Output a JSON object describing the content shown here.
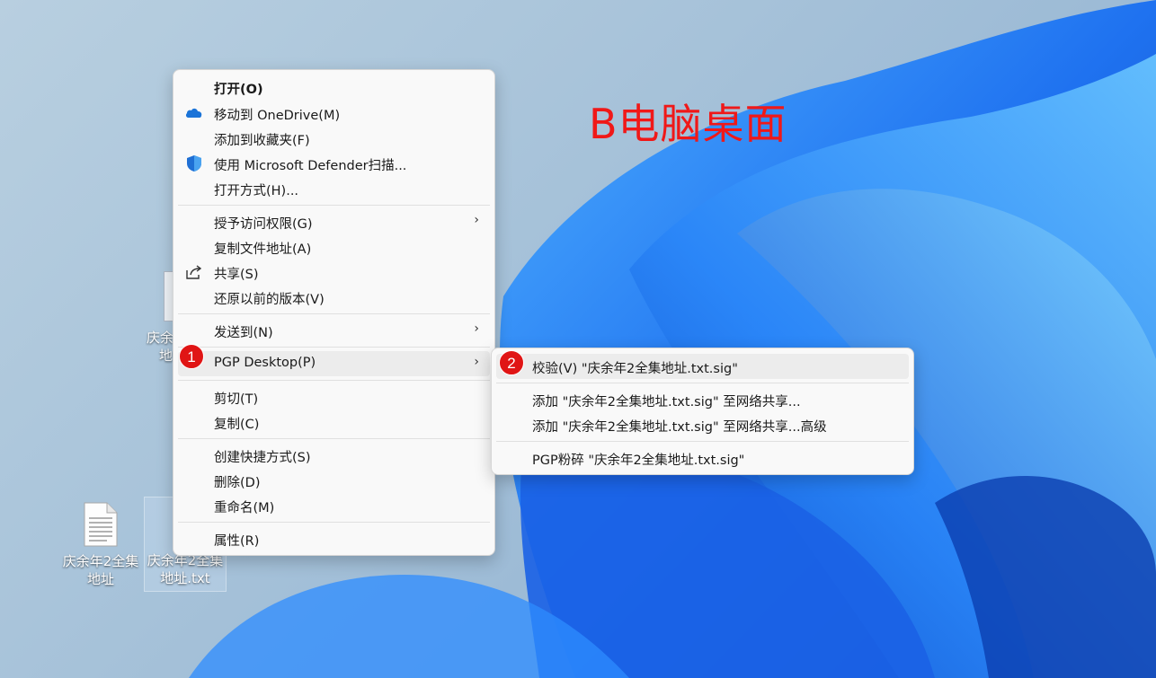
{
  "desktop": {
    "title": "B电脑桌面",
    "icons": [
      {
        "label_line1": "庆余年2全集",
        "label_line2": "地址"
      },
      {
        "label_line1": "庆余年2全集",
        "label_line2": "地址.txt"
      },
      {
        "label_partial_1": "庆余",
        "label_partial_2": "地"
      }
    ]
  },
  "context_menu": {
    "items": {
      "open": "打开(O)",
      "move_onedrive": "移动到 OneDrive(M)",
      "add_favorites": "添加到收藏夹(F)",
      "defender_scan": "使用 Microsoft Defender扫描...",
      "open_with": "打开方式(H)...",
      "grant_access": "授予访问权限(G)",
      "copy_path": "复制文件地址(A)",
      "share": "共享(S)",
      "restore_versions": "还原以前的版本(V)",
      "send_to": "发送到(N)",
      "pgp_desktop": "PGP Desktop(P)",
      "cut": "剪切(T)",
      "copy": "复制(C)",
      "create_shortcut": "创建快捷方式(S)",
      "delete": "删除(D)",
      "rename": "重命名(M)",
      "properties": "属性(R)"
    },
    "arrow": "›"
  },
  "pgp_submenu": {
    "verify": "校验(V) \"庆余年2全集地址.txt.sig\"",
    "add_share": "添加 \"庆余年2全集地址.txt.sig\" 至网络共享...",
    "add_share_adv": "添加 \"庆余年2全集地址.txt.sig\" 至网络共享...高级",
    "shred": "PGP粉碎 \"庆余年2全集地址.txt.sig\""
  },
  "badges": {
    "step1": "1",
    "step2": "2"
  },
  "colors": {
    "accent_red": "#e01515",
    "title_red": "#f01818",
    "wallpaper_blue": "#1a6ef0"
  },
  "icon_names": [
    "onedrive-icon",
    "shield-icon",
    "share-icon",
    "text-file-icon",
    "pgp-file-icon"
  ]
}
